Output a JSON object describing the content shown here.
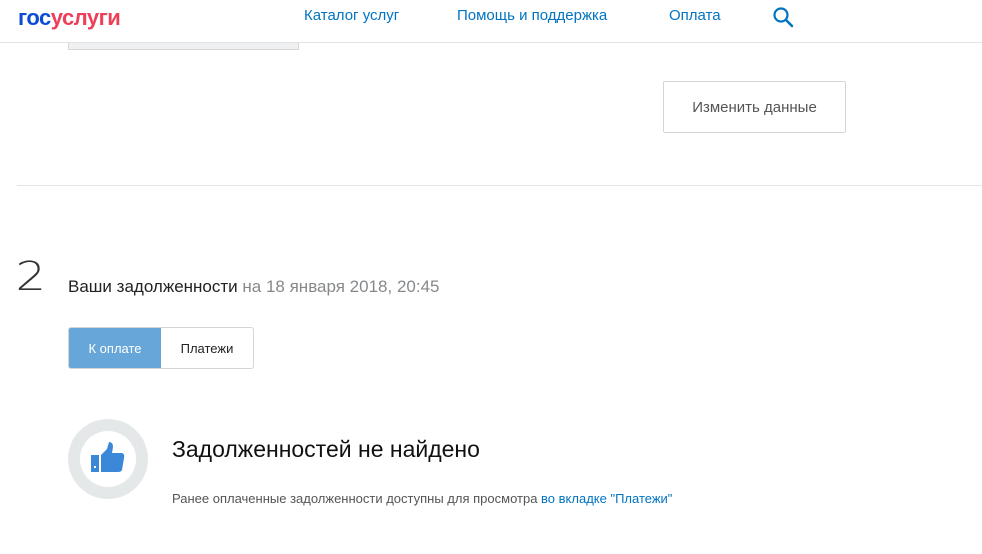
{
  "header": {
    "logo_part1": "гос",
    "logo_part2": "услуги",
    "nav": [
      "Каталог услуг",
      "Помощь и поддержка",
      "Оплата"
    ]
  },
  "profile": {
    "edit_label": "Изменить данные"
  },
  "section": {
    "number": "2",
    "title": "Ваши задолженности",
    "date": "на 18 января 2018, 20:45",
    "tabs": [
      "К оплате",
      "Платежи"
    ],
    "empty_title": "Задолженностей не найдено",
    "empty_note": "Ранее оплаченные задолженности доступны для просмотра ",
    "empty_link": "во вкладке \"Платежи\""
  }
}
